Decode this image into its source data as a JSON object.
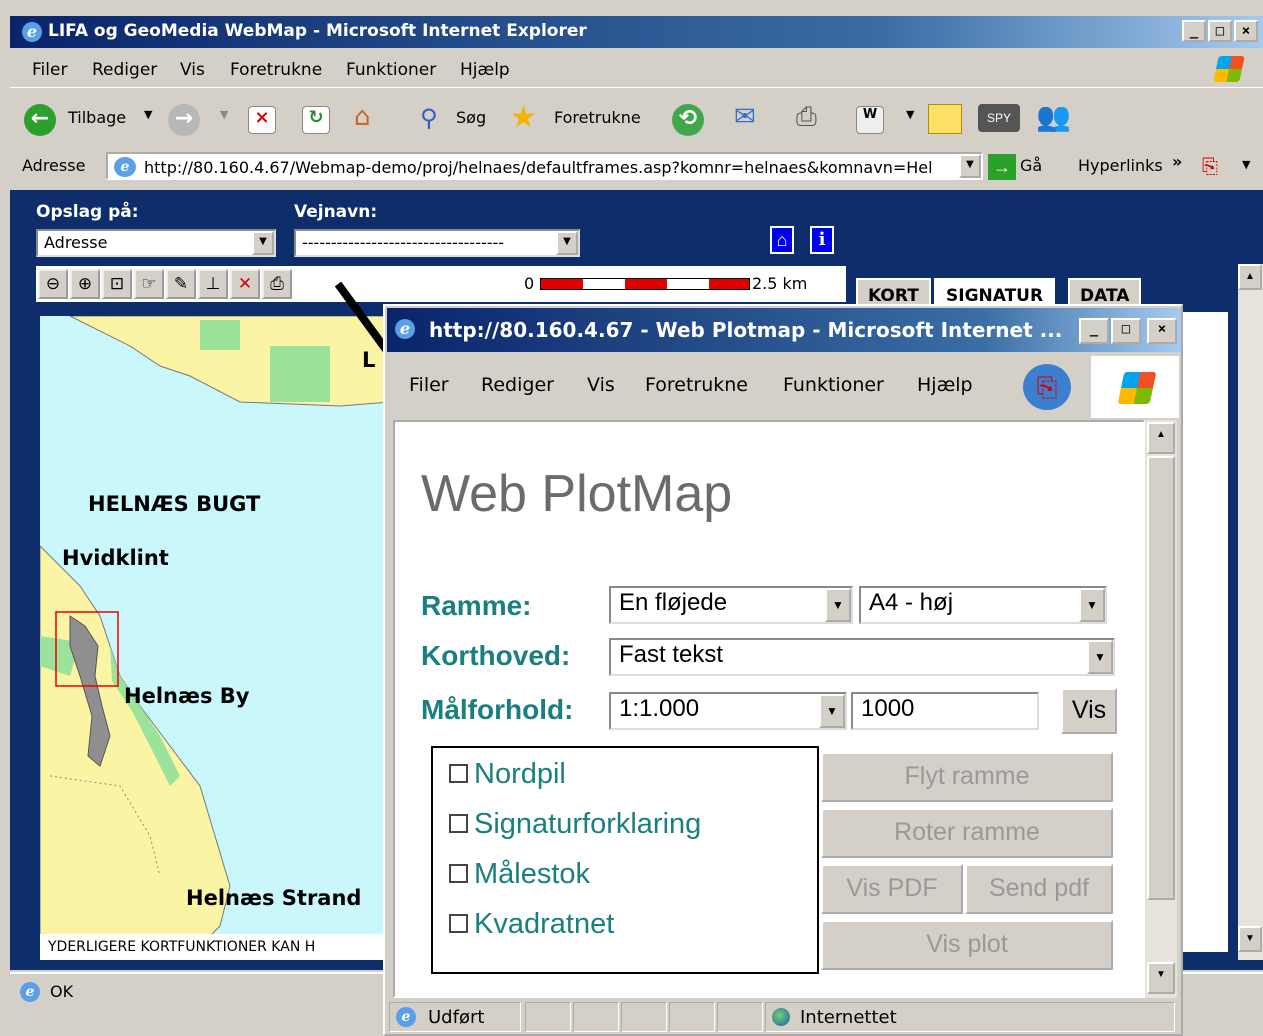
{
  "main_window": {
    "title": "LIFA og GeoMedia WebMap - Microsoft Internet Explorer",
    "menu": [
      "Filer",
      "Rediger",
      "Vis",
      "Foretrukne",
      "Funktioner",
      "Hjælp"
    ],
    "toolbar": {
      "back": "Tilbage",
      "search": "Søg",
      "favorites": "Foretrukne"
    },
    "address_label": "Adresse",
    "address_url": "http://80.160.4.67/Webmap-demo/proj/helnaes/defaultframes.asp?komnr=helnaes&komnavn=Hel",
    "go_label": "Gå",
    "links_label": "Hyperlinks",
    "status_text": "OK"
  },
  "webmap": {
    "lookup_label": "Opslag på:",
    "lookup_value": "Adresse",
    "street_label": "Vejnavn:",
    "street_value": "-----------------------------------",
    "scale_start": "0",
    "scale_end": "2.5 km",
    "tabs": [
      "KORT",
      "SIGNATUR",
      "DATA"
    ],
    "map_labels": {
      "bay": "HELNÆS BUGT",
      "hvidklint": "Hvidklint",
      "by": "Helnæs By",
      "strand": "Helnæs Strand",
      "partial": "L"
    },
    "footer": "YDERLIGERE KORTFUNKTIONER KAN H"
  },
  "popup": {
    "title": "http://80.160.4.67 - Web Plotmap - Microsoft Internet ...",
    "menu": [
      "Filer",
      "Rediger",
      "Vis",
      "Foretrukne",
      "Funktioner",
      "Hjælp"
    ],
    "heading": "Web PlotMap",
    "ramme_label": "Ramme:",
    "ramme_value": "En fløjede",
    "paper_value": "A4 - høj",
    "korthoved_label": "Korthoved:",
    "korthoved_value": "Fast tekst",
    "scale_label": "Målforhold:",
    "scale_value": "1:1.000",
    "scale_input": "1000",
    "vis_button": "Vis",
    "checkboxes": [
      "Nordpil",
      "Signaturforklaring",
      "Målestok",
      "Kvadratnet"
    ],
    "buttons": {
      "flyt": "Flyt ramme",
      "roter": "Roter ramme",
      "vis_pdf": "Vis PDF",
      "send_pdf": "Send pdf",
      "vis_plot": "Vis plot"
    },
    "status_left": "Udført",
    "status_zone": "Internettet"
  },
  "colors": {
    "title_bar": "#0a246a",
    "page_bg": "#0d2e6b",
    "map_water": "#c9f7fb",
    "map_land": "#fbf4a4",
    "map_green": "#9be39b",
    "label_teal": "#1a7f80"
  }
}
